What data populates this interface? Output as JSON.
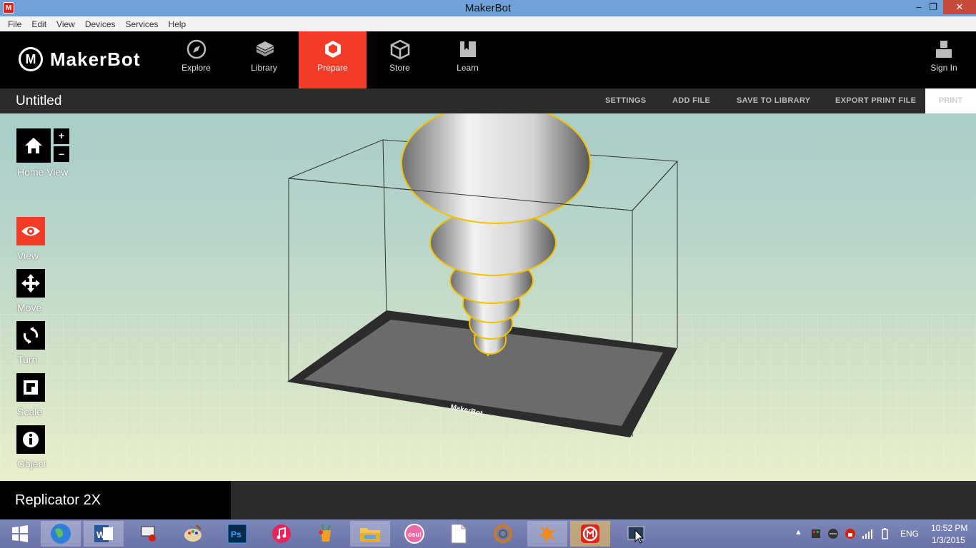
{
  "window": {
    "title": "MakerBot"
  },
  "menu": [
    "File",
    "Edit",
    "View",
    "Devices",
    "Services",
    "Help"
  ],
  "nav": {
    "logo_text": "MakerBot",
    "tabs": [
      {
        "label": "Explore",
        "icon": "compass-icon"
      },
      {
        "label": "Library",
        "icon": "library-icon"
      },
      {
        "label": "Prepare",
        "icon": "prepare-cube-icon",
        "active": true
      },
      {
        "label": "Store",
        "icon": "store-box-icon"
      },
      {
        "label": "Learn",
        "icon": "learn-book-icon"
      }
    ],
    "sign_in": "Sign In"
  },
  "toolbar": {
    "doc_title": "Untitled",
    "settings": "SETTINGS",
    "add_file": "ADD FILE",
    "save_to_library": "SAVE TO LIBRARY",
    "export_print_file": "EXPORT PRINT FILE",
    "print": "PRINT"
  },
  "tools": {
    "home_view": "Home View",
    "zoom_in": "+",
    "zoom_out": "–",
    "view": "View",
    "move": "Move",
    "turn": "Turn",
    "scale": "Scale",
    "object": "Object"
  },
  "build_plate_logo": "MakerBot",
  "bottom": {
    "printer": "Replicator 2X"
  },
  "taskbar": {
    "apps": [
      "windows-start",
      "globe-browser",
      "word",
      "remote-desktop",
      "paint",
      "photoshop",
      "itunes",
      "drink-app",
      "file-explorer",
      "osu",
      "blank-document",
      "circle-app",
      "burst-app",
      "makerbot",
      "cursor-app"
    ],
    "osu_label": "osu!",
    "ps_label": "Ps",
    "word_label": "W",
    "language": "ENG",
    "time": "10:52 PM",
    "date": "1/3/2015"
  },
  "colors": {
    "accent": "#f23c27",
    "nav_bg": "#000000",
    "toolbar_bg": "#2b2b2b",
    "selection_outline": "#f2c200"
  }
}
